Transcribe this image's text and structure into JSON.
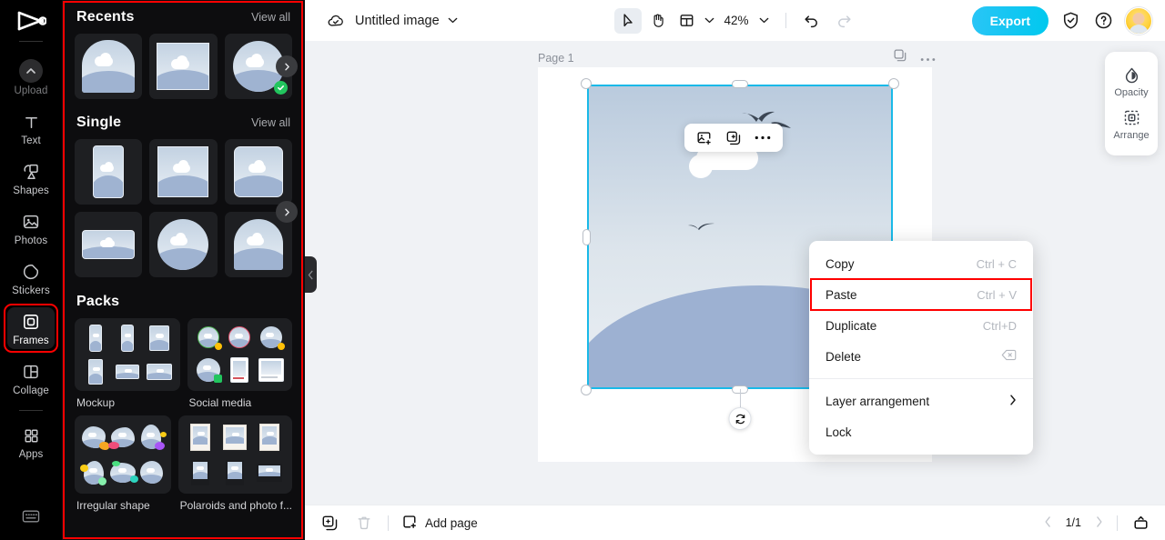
{
  "rail": {
    "logo_icon": "capcut-logo-icon",
    "items": [
      {
        "id": "upload",
        "label": "Upload",
        "icon": "chevron-up-circle-icon",
        "active": false
      },
      {
        "id": "text",
        "label": "Text",
        "icon": "text-t-icon",
        "active": false
      },
      {
        "id": "shapes",
        "label": "Shapes",
        "icon": "shapes-icon",
        "active": false
      },
      {
        "id": "photos",
        "label": "Photos",
        "icon": "photo-icon",
        "active": false
      },
      {
        "id": "stickers",
        "label": "Stickers",
        "icon": "sticker-icon",
        "active": false
      },
      {
        "id": "frames",
        "label": "Frames",
        "icon": "frame-icon",
        "active": true
      },
      {
        "id": "collage",
        "label": "Collage",
        "icon": "collage-grid-icon",
        "active": false
      },
      {
        "id": "apps",
        "label": "Apps",
        "icon": "apps-grid-icon",
        "active": false
      }
    ],
    "bottom_icon": "keyboard-shortcuts-icon"
  },
  "panel": {
    "sections": [
      {
        "title": "Recents",
        "view_all": "View all"
      },
      {
        "title": "Single",
        "view_all": "View all"
      },
      {
        "title": "Packs",
        "view_all": ""
      }
    ],
    "packs": [
      {
        "label": "Mockup"
      },
      {
        "label": "Social media"
      },
      {
        "label": "Irregular shape"
      },
      {
        "label": "Polaroids and photo f..."
      }
    ],
    "collapse_icon": "chevron-left-icon",
    "scroll_next_icon": "chevron-right-icon",
    "selected_badge_icon": "check-circle-icon"
  },
  "topbar": {
    "cloud_icon": "cloud-saved-icon",
    "doc_title": "Untitled image",
    "title_chevron_icon": "chevron-down-icon",
    "tools": [
      {
        "id": "select",
        "icon": "cursor-arrow-icon",
        "selected": true
      },
      {
        "id": "hand",
        "icon": "hand-icon",
        "selected": false
      },
      {
        "id": "layout",
        "icon": "layout-panel-icon",
        "selected": false
      }
    ],
    "layout_chevron_icon": "chevron-down-icon",
    "zoom_value": "42%",
    "zoom_chevron_icon": "chevron-down-icon",
    "undo_icon": "undo-arrow-icon",
    "redo_icon": "redo-arrow-icon",
    "export_label": "Export",
    "shield_icon": "shield-check-icon",
    "help_icon": "question-circle-icon",
    "avatar_icon": "user-avatar"
  },
  "canvas": {
    "page_label": "Page 1",
    "page_copy_icon": "duplicate-page-icon",
    "page_more_icon": "more-horizontal-icon",
    "float_toolbar": [
      {
        "id": "replace-image",
        "icon": "image-plus-icon"
      },
      {
        "id": "duplicate",
        "icon": "duplicate-icon"
      },
      {
        "id": "more",
        "icon": "more-horizontal-icon"
      }
    ],
    "rotate_icon": "rotate-icon"
  },
  "context_menu": {
    "items": [
      {
        "label": "Copy",
        "shortcut": "Ctrl + C",
        "highlighted": false,
        "submenu": false
      },
      {
        "label": "Paste",
        "shortcut": "Ctrl + V",
        "highlighted": true,
        "submenu": false
      },
      {
        "label": "Duplicate",
        "shortcut": "Ctrl+D",
        "highlighted": false,
        "submenu": false
      },
      {
        "label": "Delete",
        "shortcut": "⌫",
        "highlighted": false,
        "submenu": false
      },
      {
        "label": "Layer arrangement",
        "shortcut": "",
        "highlighted": false,
        "submenu": true
      },
      {
        "label": "Lock",
        "shortcut": "",
        "highlighted": false,
        "submenu": false
      }
    ],
    "divider_after_index": 3,
    "submenu_icon": "chevron-right-icon"
  },
  "right_panel": {
    "items": [
      {
        "label": "Opacity",
        "icon": "opacity-drop-icon"
      },
      {
        "label": "Arrange",
        "icon": "arrange-icon"
      }
    ]
  },
  "bottombar": {
    "duplicate_page_icon": "duplicate-page-icon",
    "delete_page_icon": "trash-icon",
    "add_page_icon": "square-plus-icon",
    "add_page_label": "Add page",
    "prev_icon": "chevron-left-icon",
    "page_count": "1/1",
    "next_icon": "chevron-right-icon",
    "pages_panel_icon": "pages-panel-icon"
  },
  "colors": {
    "accent_blue": "#19b9e8",
    "export_gradient_start": "#29c5f6",
    "highlight_red": "#ff0000",
    "panel_bg": "#0d0d0f",
    "rail_bg": "#000000",
    "canvas_bg": "#f0f2f5",
    "check_green": "#22c55e"
  }
}
